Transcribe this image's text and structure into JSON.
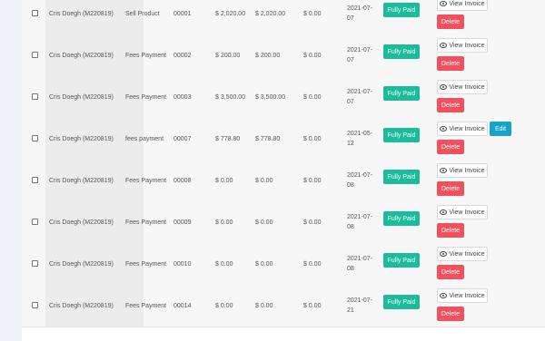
{
  "table": {
    "rows": [
      {
        "client": "Cris Doegh (M220819)",
        "type": "Sell Product",
        "number": "00001",
        "amount": "$ 2,020.00",
        "paid": "$ 2,020.00",
        "due": "$ 0.00",
        "date": "2021-07-07",
        "status": "Fully Paid",
        "view_label": "View Invoice",
        "delete_label": "Delete",
        "edit_label": ""
      },
      {
        "client": "Cris Doegh (M220819)",
        "type": "Fees Payment",
        "number": "00002",
        "amount": "$ 200.00",
        "paid": "$ 200.00",
        "due": "$ 0.00",
        "date": "2021-07-07",
        "status": "Fully Paid",
        "view_label": "View Invoice",
        "delete_label": "Delete",
        "edit_label": ""
      },
      {
        "client": "Cris Doegh (M220819)",
        "type": "Fees Payment",
        "number": "00003",
        "amount": "$ 3,500.00",
        "paid": "$ 3,500.00",
        "due": "$ 0.00",
        "date": "2021-07-07",
        "status": "Fully Paid",
        "view_label": "View Invoice",
        "delete_label": "Delete",
        "edit_label": ""
      },
      {
        "client": "Cris Doegh (M220819)",
        "type": "fees payment",
        "number": "00007",
        "amount": "$ 778.80",
        "paid": "$ 778.80",
        "due": "$ 0.00",
        "date": "2021-05-12",
        "status": "Fully Paid",
        "view_label": "View Invoice",
        "delete_label": "Delete",
        "edit_label": "Edit"
      },
      {
        "client": "Cris Doegh (M220819)",
        "type": "Fees Payment",
        "number": "00008",
        "amount": "$ 0.00",
        "paid": "$ 0.00",
        "due": "$ 0.00",
        "date": "2021-07-08",
        "status": "Fully Paid",
        "view_label": "View Invoice",
        "delete_label": "Delete",
        "edit_label": ""
      },
      {
        "client": "Cris Doegh (M220819)",
        "type": "Fees Payment",
        "number": "00009",
        "amount": "$ 0.00",
        "paid": "$ 0.00",
        "due": "$ 0.00",
        "date": "2021-07-08",
        "status": "Fully Paid",
        "view_label": "View Invoice",
        "delete_label": "Delete",
        "edit_label": ""
      },
      {
        "client": "Cris Doegh (M220819)",
        "type": "Fees Payment",
        "number": "00010",
        "amount": "$ 0.00",
        "paid": "$ 0.00",
        "due": "$ 0.00",
        "date": "2021-07-08",
        "status": "Fully Paid",
        "view_label": "View Invoice",
        "delete_label": "Delete",
        "edit_label": ""
      },
      {
        "client": "Cris Doegh (M220819)",
        "type": "Fees Payment",
        "number": "00014",
        "amount": "$ 0.00",
        "paid": "$ 0.00",
        "due": "$ 0.00",
        "date": "2021-07-21",
        "status": "Fully Paid",
        "view_label": "View Invoice",
        "delete_label": "Delete",
        "edit_label": ""
      }
    ]
  },
  "icons": {
    "view": "eye-icon",
    "select": "checkbox"
  },
  "colors": {
    "paid": "#1abc9c",
    "delete": "#f0515c",
    "edit": "#17a2c8"
  }
}
